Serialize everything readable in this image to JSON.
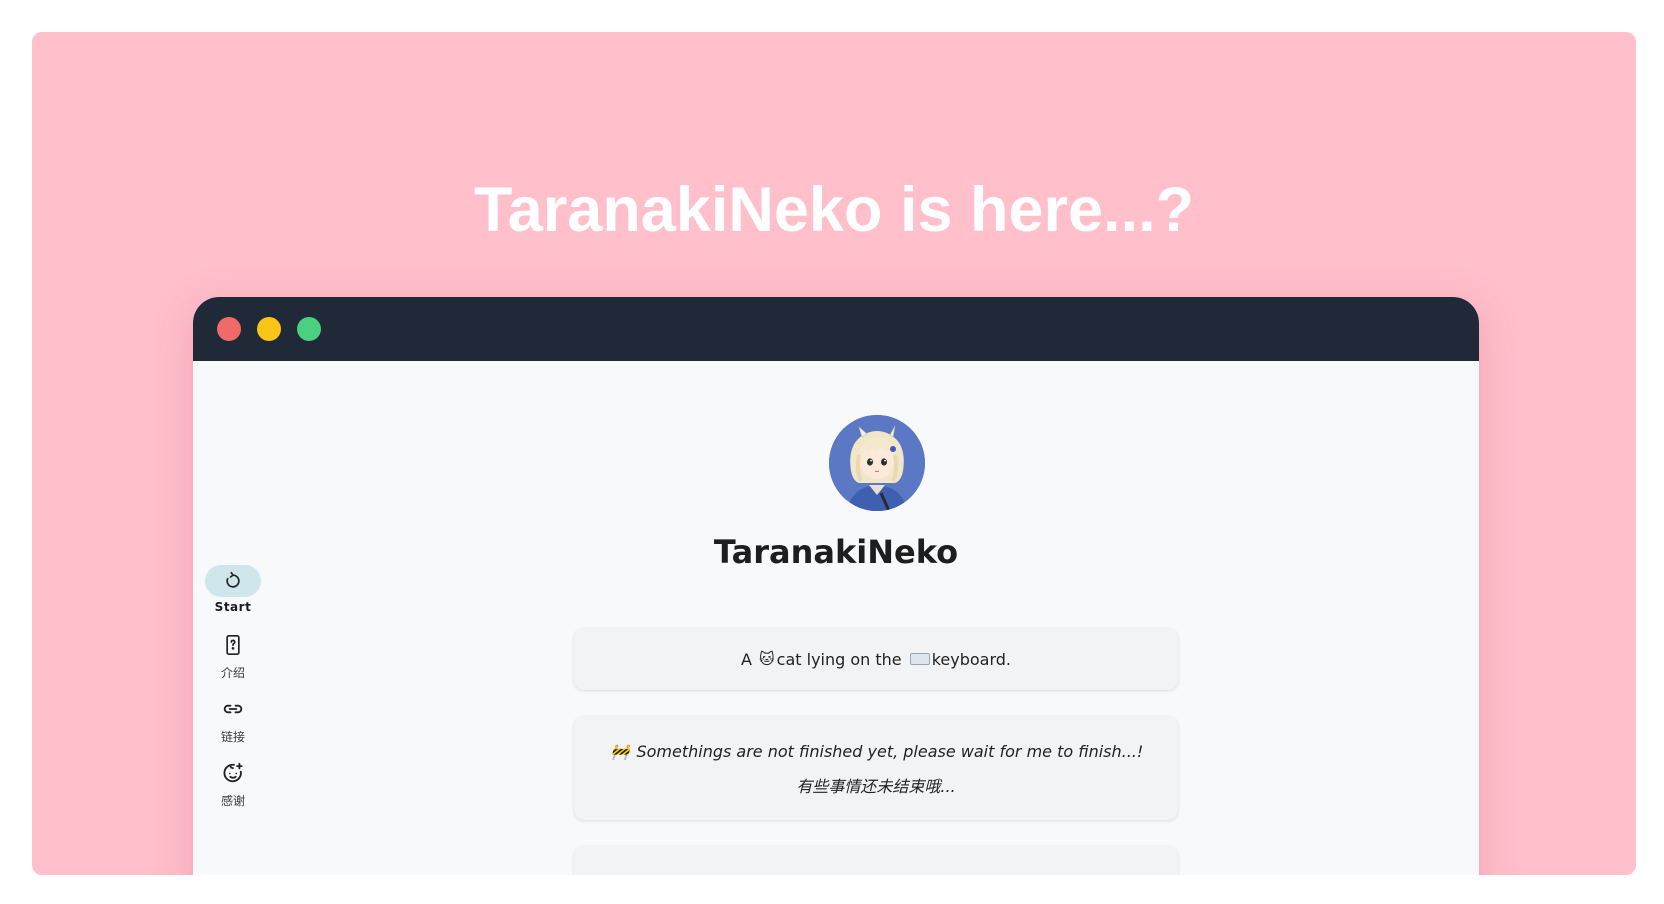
{
  "banner": {
    "title": "TaranakiNeko is here...?",
    "background": "#ffbfcb"
  },
  "window": {
    "titlebar_color": "#1f2937",
    "controls": [
      "close",
      "minimize",
      "maximize"
    ]
  },
  "nav": {
    "items": [
      {
        "label": "Start",
        "icon": "refresh-icon",
        "active": true
      },
      {
        "label": "介绍",
        "icon": "phone-question-icon",
        "active": false
      },
      {
        "label": "链接",
        "icon": "link-icon",
        "active": false
      },
      {
        "label": "感谢",
        "icon": "baby-face-icon",
        "active": false
      }
    ]
  },
  "profile": {
    "avatar": "anime-avatar",
    "name": "TaranakiNeko"
  },
  "cards": {
    "intro": {
      "prefix": "A ",
      "emoji_cat": "🐱",
      "mid": "cat lying on the ",
      "emoji_keyboard": "keyboard-icon",
      "suffix": "keyboard."
    },
    "notice": {
      "emoji": "🚧",
      "line1": "Somethings are not finished yet, please wait for me to finish...!",
      "line2": "有些事情还未结束哦..."
    }
  }
}
